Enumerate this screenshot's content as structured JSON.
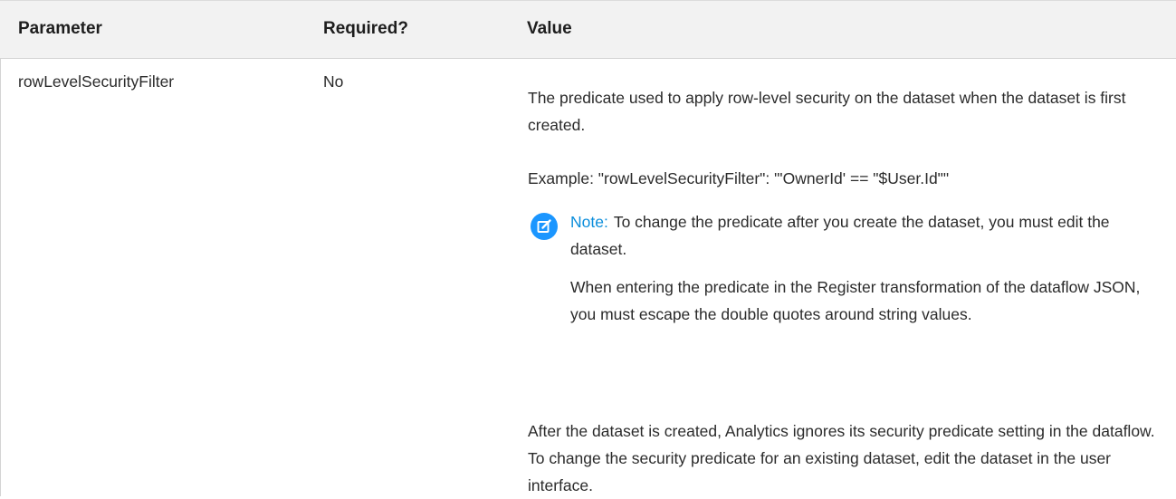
{
  "table": {
    "headers": {
      "parameter": "Parameter",
      "required": "Required?",
      "value": "Value"
    },
    "row": {
      "parameter": "rowLevelSecurityFilter",
      "required": "No",
      "value": {
        "description": "The predicate used to apply row-level security on the dataset when the dataset is first created.",
        "example": "Example: \"rowLevelSecurityFilter\": \"'OwnerId' == \"$User.Id\"\"",
        "note": {
          "label": "Note:",
          "text": "To change the predicate after you create the dataset, you must edit the dataset.",
          "extra": "When entering the predicate in the Register transformation of the dataflow JSON, you must escape the double quotes around string values.",
          "icon": "edit-note-icon",
          "icon_color": "#1b96ff",
          "label_color": "#0a8ddb"
        },
        "after": "After the dataset is created, Analytics ignores its security predicate setting in the dataflow. To change the security predicate for an existing dataset, edit the dataset in the user interface."
      }
    }
  }
}
